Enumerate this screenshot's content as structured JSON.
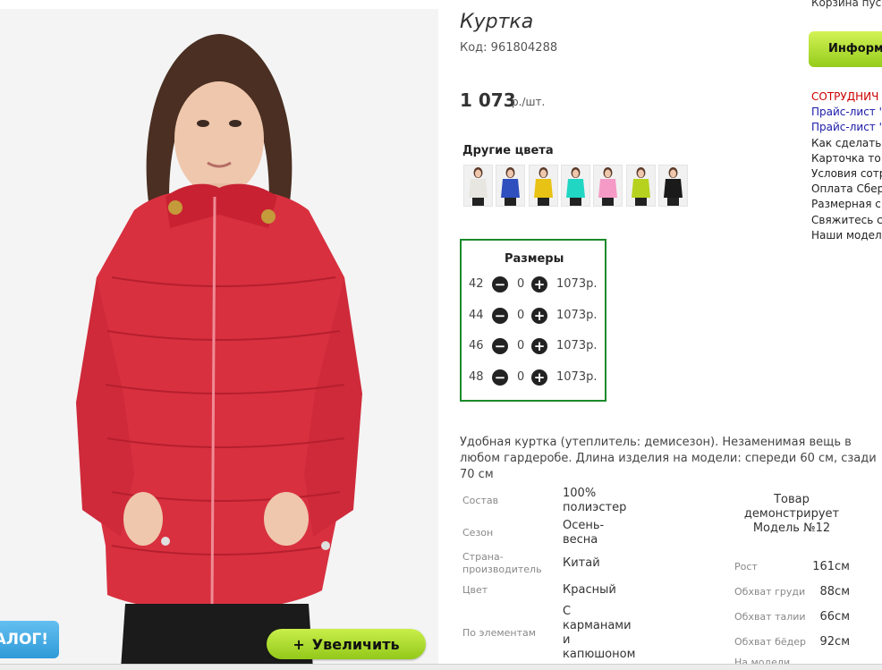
{
  "product": {
    "title": "Куртка",
    "code": "Код: 961804288",
    "price": "1 073",
    "price_unit": "р./шт.",
    "other_colors_label": "Другие цвета",
    "colors": [
      "#e8e6e0",
      "#2f4fbf",
      "#e8c214",
      "#22d6c4",
      "#f59ac6",
      "#b7d21e",
      "#1a1a1a"
    ],
    "sizes_title": "Размеры",
    "sizes": [
      {
        "size": "42",
        "qty": "0",
        "price": "1073р."
      },
      {
        "size": "44",
        "qty": "0",
        "price": "1073р."
      },
      {
        "size": "46",
        "qty": "0",
        "price": "1073р."
      },
      {
        "size": "48",
        "qty": "0",
        "price": "1073р."
      }
    ],
    "description": "Удобная куртка (утеплитель: демисезон). Незаменимая вещь в любом гардеробе. Длина изделия на модели: спереди 60 см, сзади 70 см",
    "specs": [
      {
        "label": "Состав",
        "value": "100% полиэстер"
      },
      {
        "label": "Сезон",
        "value": "Осень-весна"
      },
      {
        "label": "Страна-производитель",
        "value": "Китай"
      },
      {
        "label": "Цвет",
        "value": "Красный"
      },
      {
        "label": "По элементам",
        "value": "С карманами и капюшоном"
      }
    ],
    "model_demo": "Товар демонстрирует Модель №12",
    "model_params": [
      {
        "label": "Рост",
        "value": "161см"
      },
      {
        "label": "Обхват груди",
        "value": "88см"
      },
      {
        "label": "Обхват талии",
        "value": "66см"
      },
      {
        "label": "Обхват бёдер",
        "value": "92см"
      },
      {
        "label": "На модели",
        "value": ""
      }
    ],
    "zoom_label": "Увеличить",
    "zoom_icon": "+",
    "catalog_label": "АЛОГ!"
  },
  "sidebar": {
    "cart": "Корзина пус",
    "info_button": "Информа",
    "links": [
      {
        "label": "СОТРУДНИЧ",
        "color": "#cc0000"
      },
      {
        "label": "Прайс-лист '",
        "color": "#1a1aa8"
      },
      {
        "label": "Прайс-лист '",
        "color": "#1a1aa8"
      },
      {
        "label": "Как сделать",
        "color": "#222222"
      },
      {
        "label": "Карточка то",
        "color": "#222222"
      },
      {
        "label": "Условия сотр",
        "color": "#222222"
      },
      {
        "label": "Оплата Сбер",
        "color": "#222222"
      },
      {
        "label": "Размерная с",
        "color": "#222222"
      },
      {
        "label": "Свяжитесь с",
        "color": "#222222"
      },
      {
        "label": "Наши модел",
        "color": "#222222"
      }
    ]
  }
}
